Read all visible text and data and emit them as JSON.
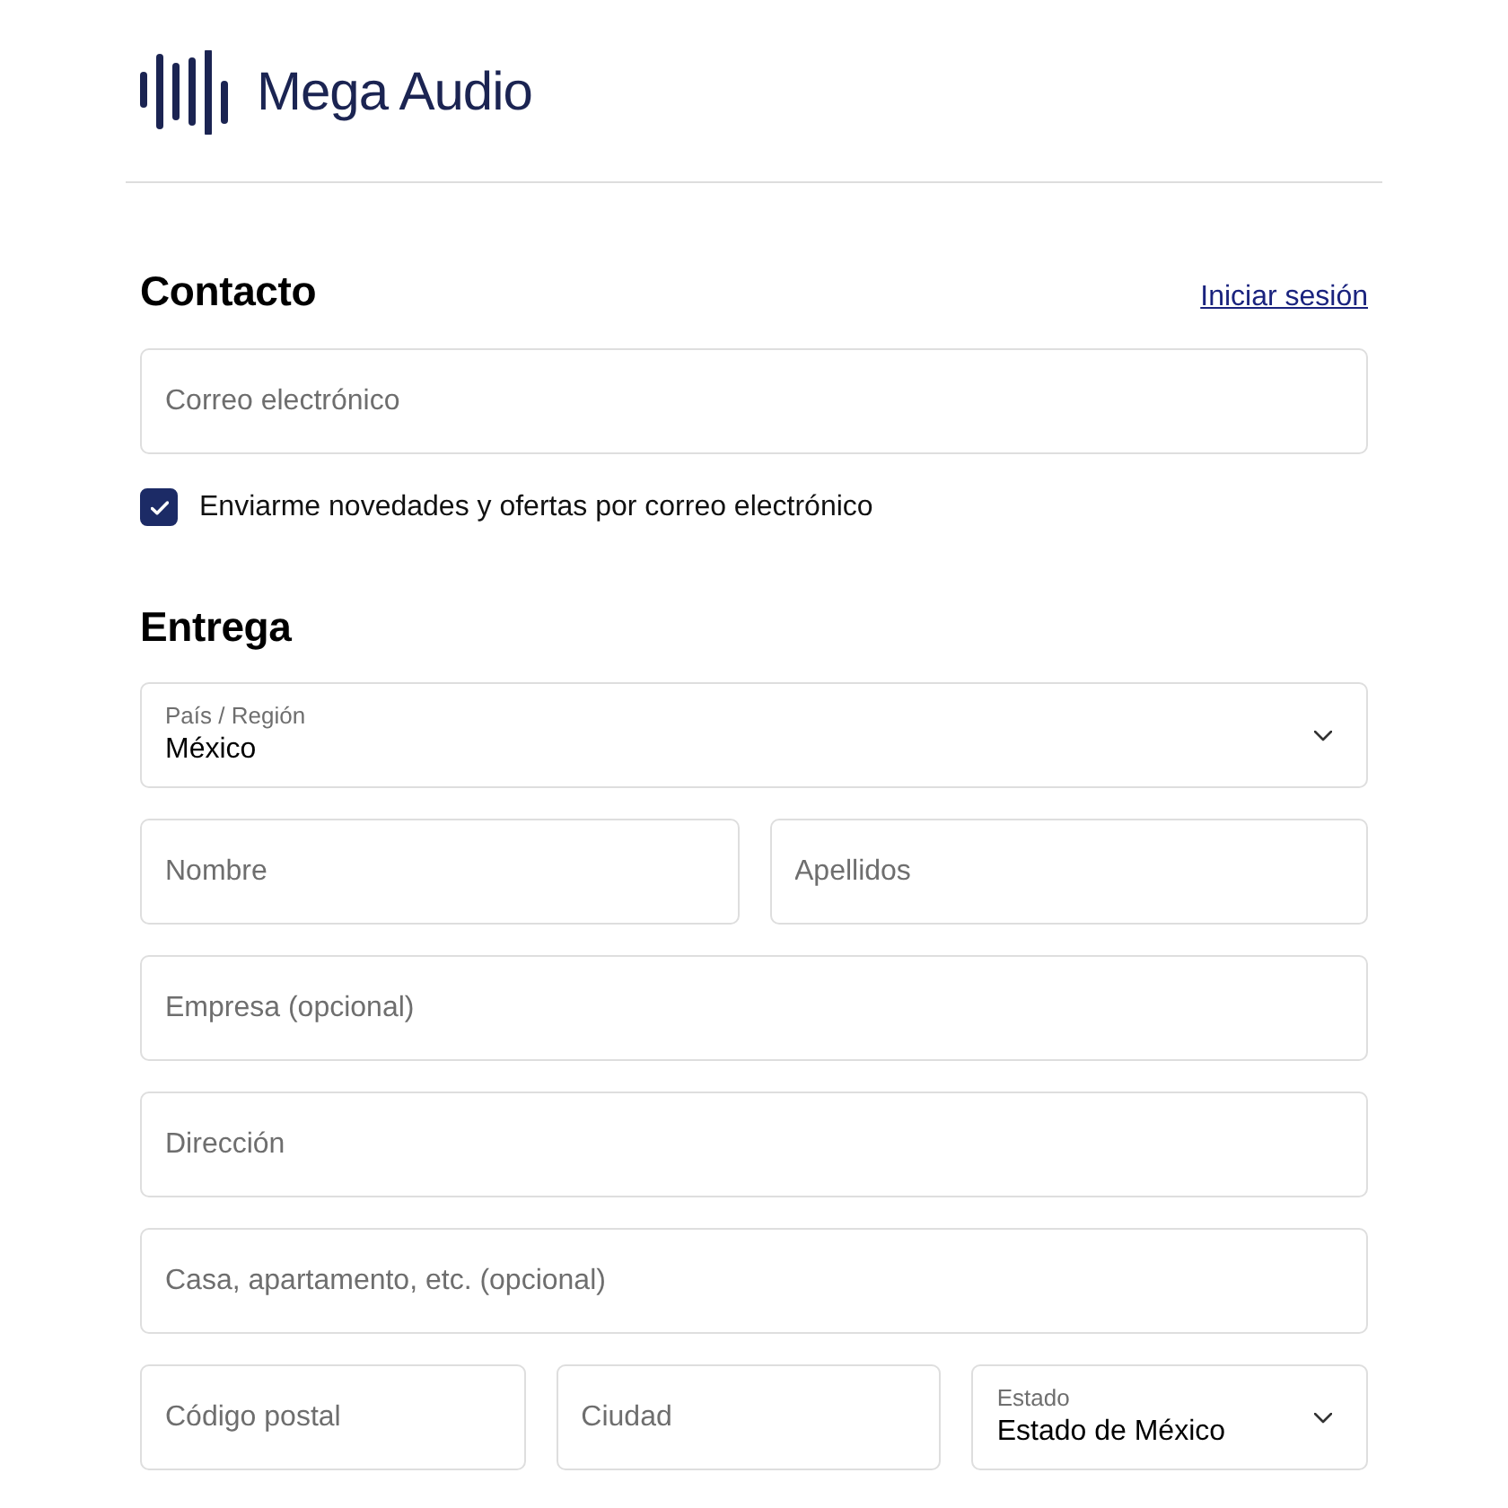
{
  "header": {
    "brand": "Mega Audio"
  },
  "contact": {
    "title": "Contacto",
    "login_link": "Iniciar sesión",
    "email": {
      "placeholder": "Correo electrónico"
    },
    "newsletter": {
      "label": "Enviarme novedades y ofertas por correo electrónico",
      "checked": true
    }
  },
  "delivery": {
    "title": "Entrega",
    "rows": [
      {
        "fields": [
          {
            "kind": "select",
            "label": "País / Región",
            "value": "México"
          }
        ]
      },
      {
        "fields": [
          {
            "kind": "text",
            "placeholder": "Nombre"
          },
          {
            "kind": "text",
            "placeholder": "Apellidos"
          }
        ]
      },
      {
        "fields": [
          {
            "kind": "text",
            "placeholder": "Empresa (opcional)"
          }
        ]
      },
      {
        "fields": [
          {
            "kind": "text",
            "placeholder": "Dirección"
          }
        ]
      },
      {
        "fields": [
          {
            "kind": "text",
            "placeholder": "Casa, apartamento, etc. (opcional)"
          }
        ]
      },
      {
        "fields": [
          {
            "kind": "text",
            "placeholder": "Código postal"
          },
          {
            "kind": "text",
            "placeholder": "Ciudad"
          },
          {
            "kind": "select",
            "label": "Estado",
            "value": "Estado de México"
          }
        ]
      }
    ]
  }
}
